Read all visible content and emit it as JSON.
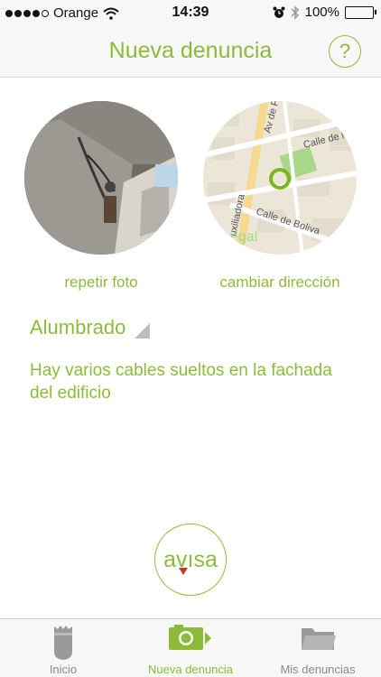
{
  "status_bar": {
    "carrier": "Orange",
    "time": "14:39",
    "battery_percent": "100%",
    "signal_bars": 4,
    "signal_total": 5,
    "icons": [
      "wifi-icon",
      "alarm-icon",
      "bluetooth-icon",
      "battery-icon"
    ]
  },
  "nav": {
    "title": "Nueva denuncia",
    "help_label": "?"
  },
  "photo": {
    "action_label": "repetir foto"
  },
  "map": {
    "action_label": "cambiar dirección",
    "street_labels": [
      "Calle de los Tilos",
      "Av de F",
      "Calle de Boliva",
      "uxiliadora",
      "egal"
    ],
    "marker_color": "#7cb51f"
  },
  "report": {
    "category": "Alumbrado",
    "description": "Hay varios cables sueltos en la fachada del edificio"
  },
  "logo": {
    "text_left": "av",
    "text_right": "sa"
  },
  "tabs": [
    {
      "label": "Inicio",
      "icon": "shield-icon",
      "active": false
    },
    {
      "label": "Nueva denuncia",
      "icon": "camera-icon",
      "active": true
    },
    {
      "label": "Mis denuncias",
      "icon": "folder-icon",
      "active": false
    }
  ],
  "colors": {
    "accent": "#8cbb3a",
    "inactive": "#8a8a8a",
    "bar_background": "#f7f7f7"
  }
}
